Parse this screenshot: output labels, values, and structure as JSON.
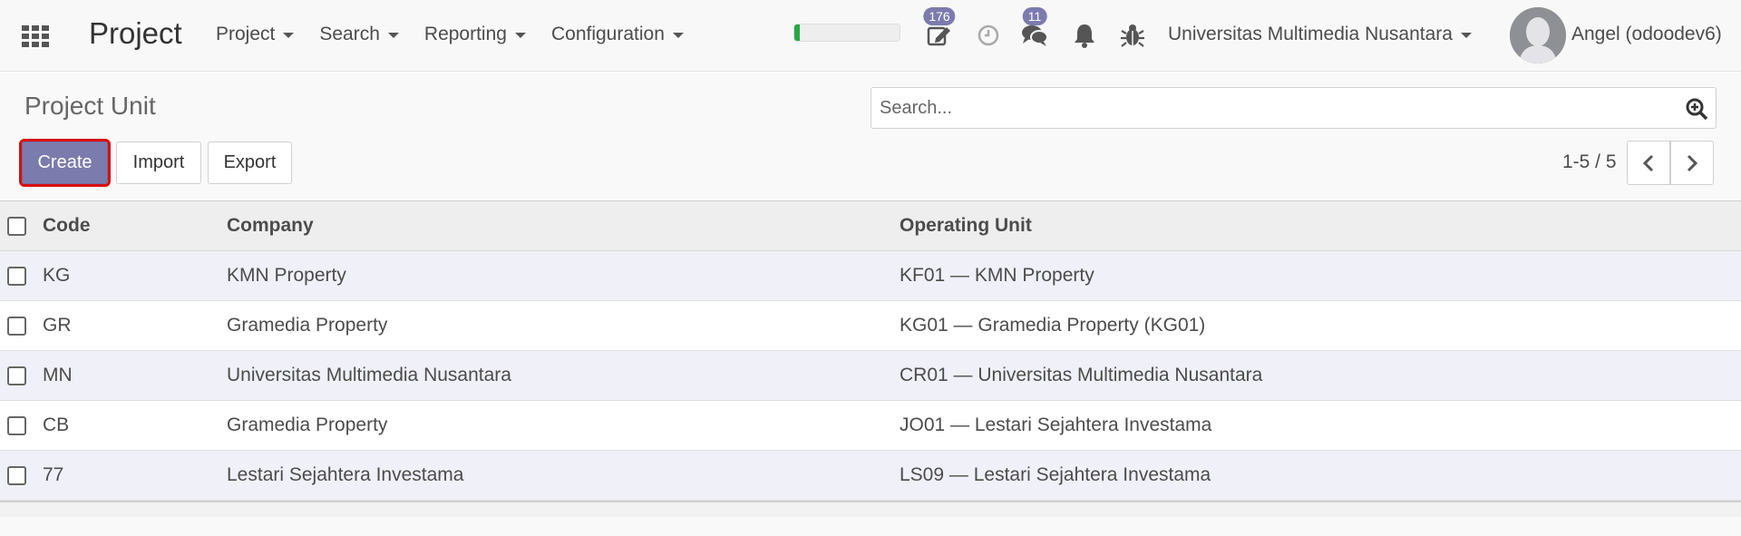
{
  "navbar": {
    "brand": "Project",
    "menu": [
      {
        "label": "Project"
      },
      {
        "label": "Search"
      },
      {
        "label": "Reporting"
      },
      {
        "label": "Configuration"
      }
    ],
    "progress_fraction": 0.05,
    "activity_badge": "176",
    "messages_badge": "11",
    "company": "Universitas Multimedia Nusantara",
    "user": "Angel (odoodev6)",
    "icons": [
      "apps-grid-icon",
      "edit-icon",
      "clock-icon",
      "chat-icon",
      "bell-icon",
      "bug-icon"
    ]
  },
  "control_panel": {
    "title": "Project Unit",
    "search_placeholder": "Search...",
    "buttons": {
      "create": "Create",
      "import": "Import",
      "export": "Export"
    },
    "pager": "1-5 / 5"
  },
  "table": {
    "columns": [
      "Code",
      "Company",
      "Operating Unit"
    ],
    "rows": [
      {
        "code": "KG",
        "company": "KMN Property",
        "operating_unit": "KF01 — KMN Property"
      },
      {
        "code": "GR",
        "company": "Gramedia Property",
        "operating_unit": "KG01 — Gramedia Property (KG01)"
      },
      {
        "code": "MN",
        "company": "Universitas Multimedia Nusantara",
        "operating_unit": "CR01 — Universitas Multimedia Nusantara"
      },
      {
        "code": "CB",
        "company": "Gramedia Property",
        "operating_unit": "JO01 — Lestari Sejahtera Investama"
      },
      {
        "code": "77",
        "company": "Lestari Sejahtera Investama",
        "operating_unit": "LS09 — Lestari Sejahtera Investama"
      }
    ]
  },
  "colors": {
    "primary": "#7c7bad",
    "highlight_outline": "#d90d0d",
    "progress": "#28a745"
  }
}
